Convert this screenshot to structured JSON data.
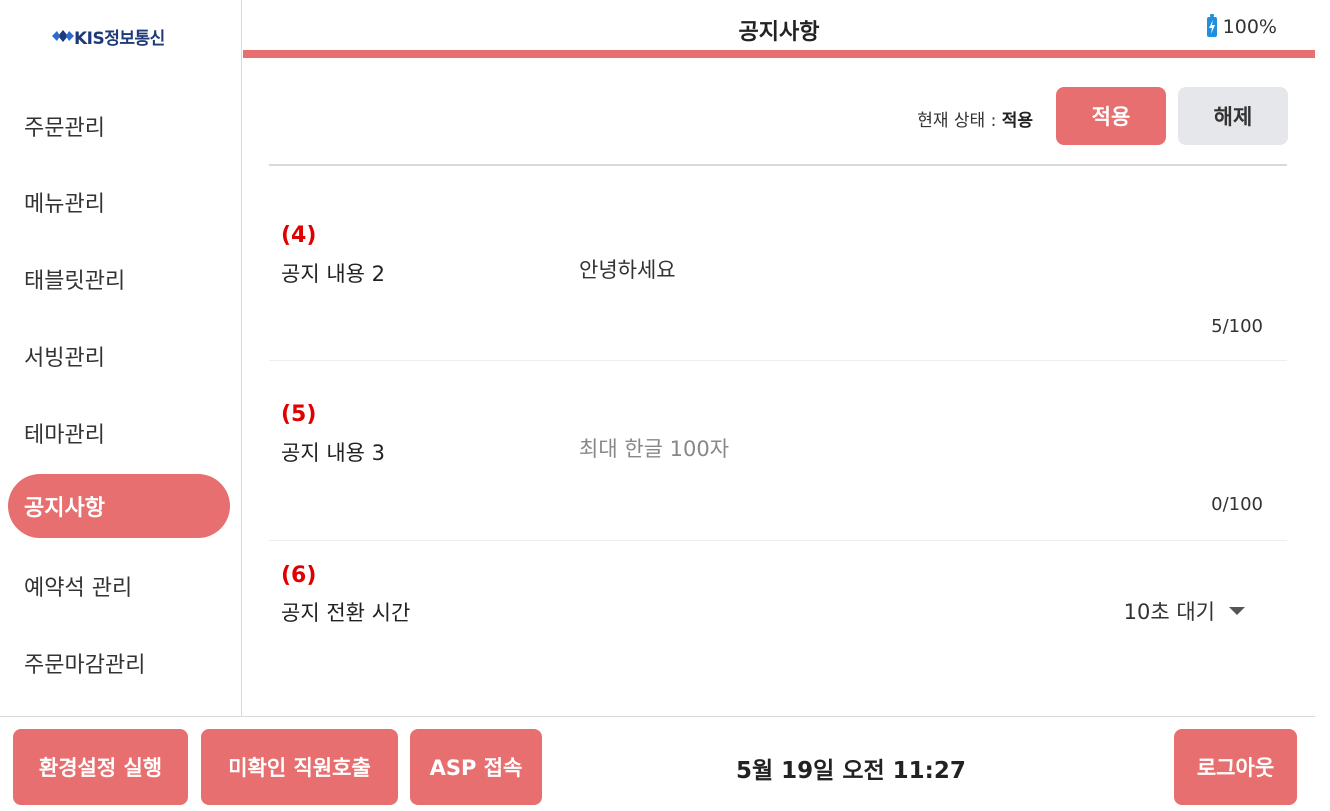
{
  "brand": {
    "logo_text": "KIS정보통신",
    "colors": {
      "accent": "#e86f6f",
      "brand_blue": "#1e3a7a",
      "battery_blue": "#1f8fe0",
      "red_marker": "#e00000"
    }
  },
  "header": {
    "title": "공지사항",
    "battery_percent": "100%"
  },
  "sidebar": {
    "items": [
      {
        "label": "주문관리",
        "active": false
      },
      {
        "label": "메뉴관리",
        "active": false
      },
      {
        "label": "태블릿관리",
        "active": false
      },
      {
        "label": "서빙관리",
        "active": false
      },
      {
        "label": "테마관리",
        "active": false
      },
      {
        "label": "공지사항",
        "active": true
      },
      {
        "label": "예약석 관리",
        "active": false
      },
      {
        "label": "주문마감관리",
        "active": false
      }
    ]
  },
  "status": {
    "prefix": "현재 상태 : ",
    "value": "적용",
    "apply_label": "적용",
    "release_label": "해제"
  },
  "rows": [
    {
      "num": "(4)",
      "label": "공지 내용 2",
      "value": "안녕하세요",
      "count": "5/100"
    },
    {
      "num": "(5)",
      "label": "공지 내용 3",
      "placeholder": "최대 한글 100자",
      "count": "0/100"
    },
    {
      "num": "(6)",
      "label": "공지 전환 시간",
      "select_value": "10초 대기"
    }
  ],
  "footer": {
    "btn_settings": "환경설정 실행",
    "btn_staff_call": "미확인 직원호출",
    "btn_asp": "ASP 접속",
    "datetime": "5월 19일 오전 11:27",
    "btn_logout": "로그아웃"
  },
  "icons": [
    "logo-diamond-icon",
    "battery-icon",
    "chevron-down-icon"
  ]
}
